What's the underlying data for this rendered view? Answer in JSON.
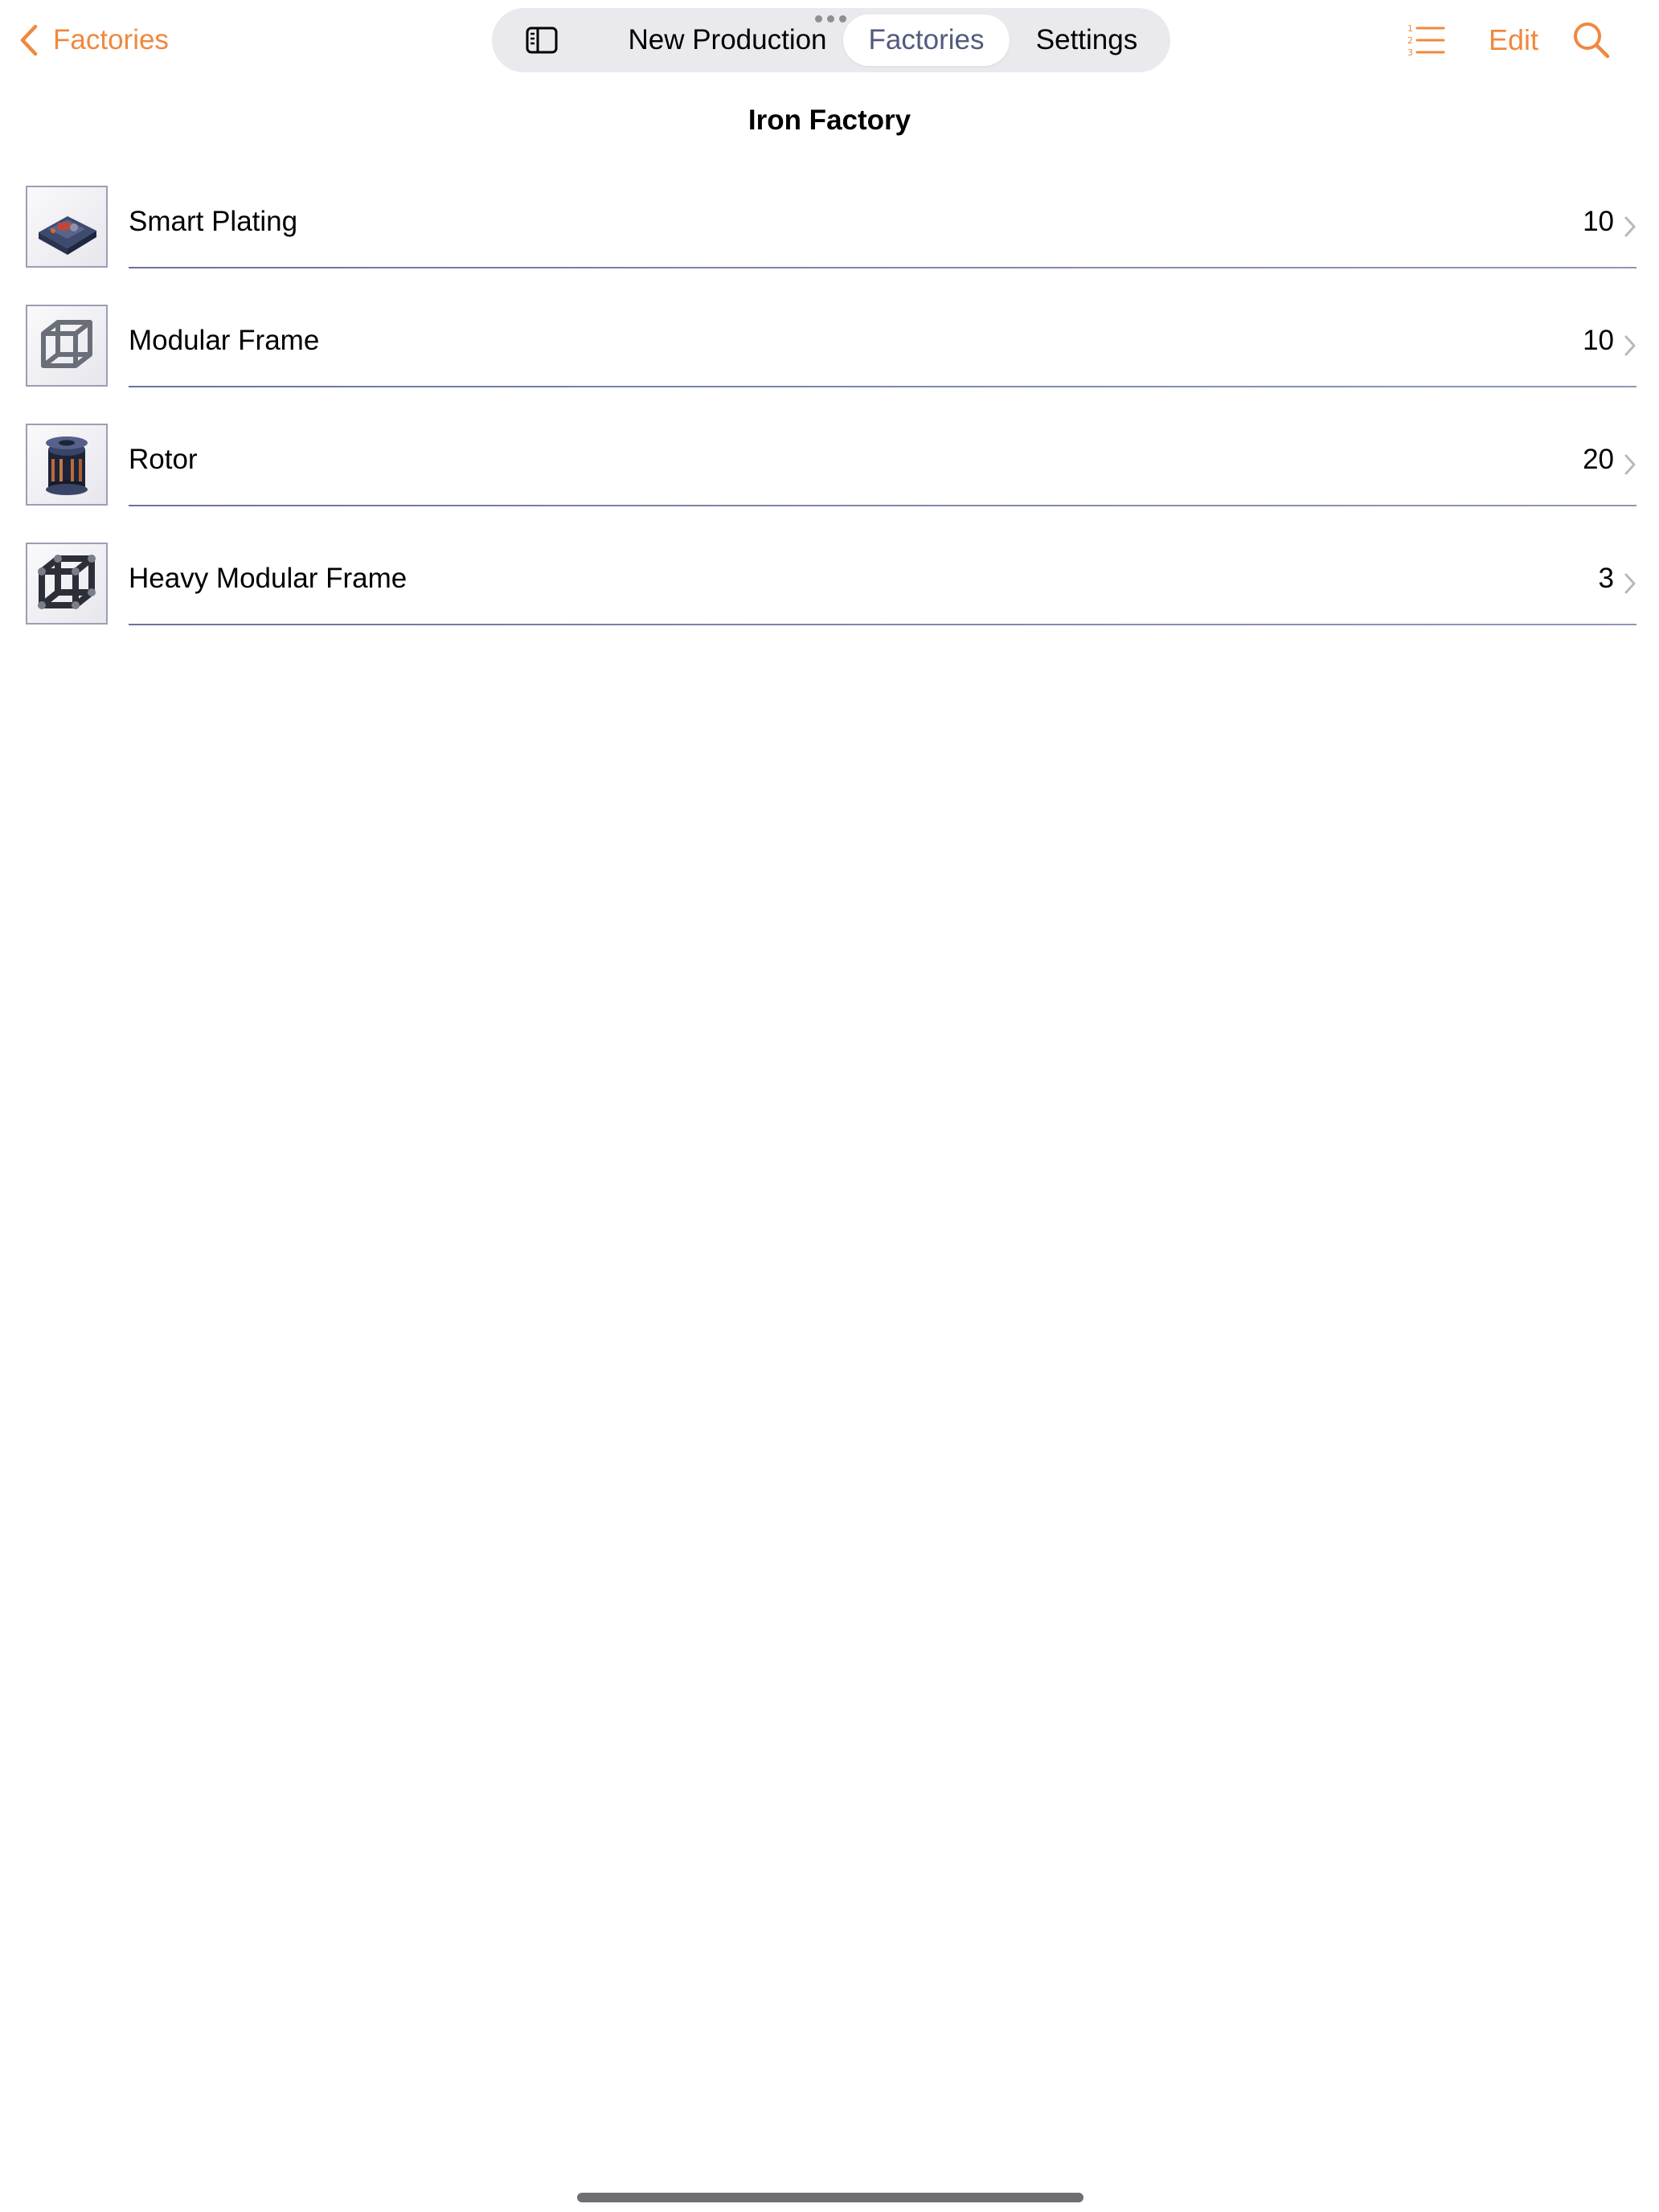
{
  "nav": {
    "back_label": "Factories",
    "edit_label": "Edit"
  },
  "tabs": [
    {
      "label": "New Production",
      "selected": false
    },
    {
      "label": "Factories",
      "selected": true
    },
    {
      "label": "Settings",
      "selected": false
    }
  ],
  "page": {
    "title": "Iron Factory"
  },
  "items": [
    {
      "name": "Smart Plating",
      "count": "10",
      "icon": "smart-plating-icon"
    },
    {
      "name": "Modular Frame",
      "count": "10",
      "icon": "modular-frame-icon"
    },
    {
      "name": "Rotor",
      "count": "20",
      "icon": "rotor-icon"
    },
    {
      "name": "Heavy Modular Frame",
      "count": "3",
      "icon": "heavy-modular-frame-icon"
    }
  ],
  "colors": {
    "accent": "#F0883E",
    "selected_tab_text": "#525A7E",
    "separator": "#7C83A8",
    "tab_bar_background": "#E9E9EE"
  },
  "icons": {
    "back": "chevron-left-icon",
    "sidebar": "sidebar-icon",
    "numbered_list": "numbered-list-icon",
    "search": "magnifying-glass-icon",
    "row_disclosure": "chevron-right-icon"
  }
}
